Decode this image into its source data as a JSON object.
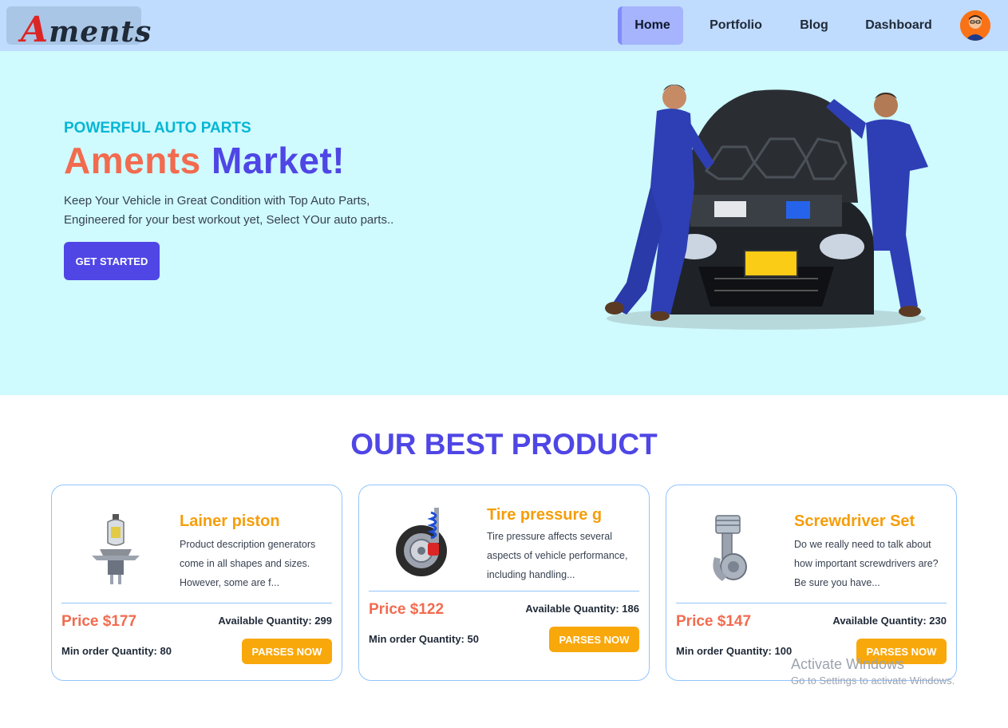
{
  "nav": {
    "logo": "Aments",
    "items": [
      "Home",
      "Portfolio",
      "Blog",
      "Dashboard"
    ],
    "active": "Home"
  },
  "hero": {
    "tagline": "POWERFUL AUTO PARTS",
    "title_part1": "Aments",
    "title_part2": "Market!",
    "desc_line1": "Keep Your Vehicle in Great Condition with Top Auto Parts,",
    "desc_line2": "Engineered for your best workout yet, Select YOur auto parts..",
    "cta": "GET STARTED"
  },
  "products_section": {
    "title": "OUR BEST PRODUCT",
    "products": [
      {
        "name": "Lainer piston",
        "description": "Product description generators come in all shapes and sizes. However, some are f...",
        "price": "Price $177",
        "available": "Available Quantity: 299",
        "min_order": "Min order Quantity: 80",
        "button": "PARSES NOW",
        "image_icon": "headlight-bulb-icon"
      },
      {
        "name": "Tire pressure g",
        "description": "Tire pressure affects several aspects of vehicle performance, including handling...",
        "price": "Price $122",
        "available": "Available Quantity: 186",
        "min_order": "Min order Quantity: 50",
        "button": "PARSES NOW",
        "image_icon": "tire-suspension-icon"
      },
      {
        "name": "Screwdriver Set",
        "description": "Do we really need to talk about how important screwdrivers are? Be sure you have...",
        "price": "Price $147",
        "available": "Available Quantity: 230",
        "min_order": "Min order Quantity: 100",
        "button": "PARSES NOW",
        "image_icon": "piston-icon"
      }
    ]
  },
  "watermark": {
    "line1": "Activate Windows",
    "line2": "Go to Settings to activate Windows."
  },
  "colors": {
    "nav_bg": "#bfdbfe",
    "hero_bg": "#cffafe",
    "accent_blue": "#4f46e5",
    "accent_cyan": "#06b6d4",
    "accent_coral": "#f26b4f",
    "accent_amber": "#f59e0b",
    "card_border": "#93c5fd"
  }
}
